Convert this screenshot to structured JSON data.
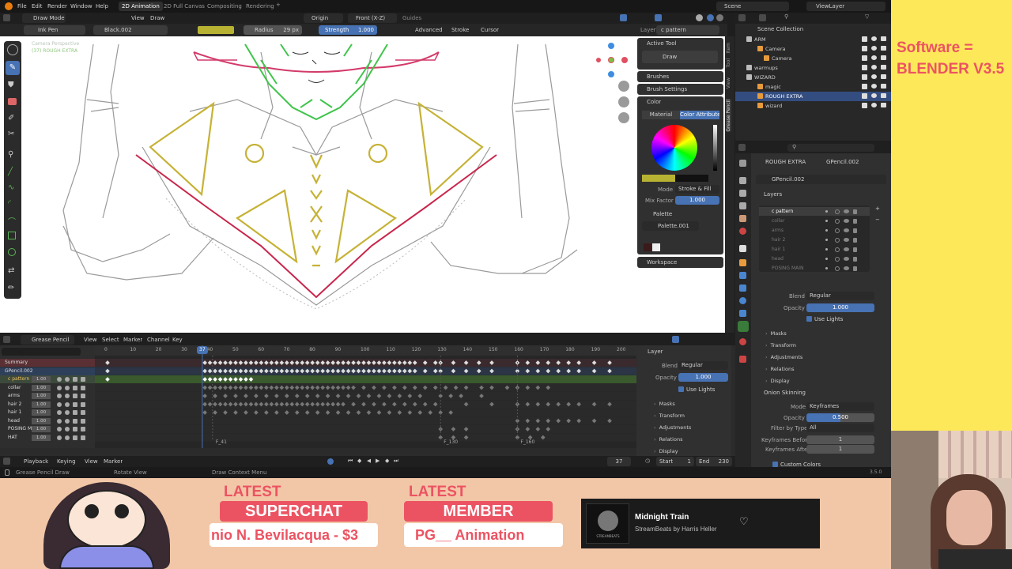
{
  "menubar": {
    "items": [
      "File",
      "Edit",
      "Render",
      "Window",
      "Help"
    ],
    "workspaces": [
      "2D Animation",
      "2D Full Canvas",
      "Compositing",
      "Rendering"
    ],
    "scene": "Scene",
    "viewlayer": "ViewLayer"
  },
  "toolbar": {
    "mode": "Draw Mode",
    "view": "View",
    "draw": "Draw",
    "origin": "Origin",
    "projection": "Front (X-Z)",
    "guides": "Guides"
  },
  "toolsettings": {
    "brush": "Ink Pen",
    "material": "Black.002",
    "radius_label": "Radius",
    "radius_value": "29 px",
    "strength_label": "Strength",
    "strength_value": "1.000",
    "advanced": "Advanced",
    "stroke": "Stroke",
    "cursor": "Cursor",
    "layer_label": "Layer",
    "layer_value": "c pattern"
  },
  "viewport": {
    "camera_text": "Camera Perspective",
    "object_text": "(37) ROUGH EXTRA"
  },
  "npanel": {
    "active_tool": "Active Tool",
    "draw": "Draw",
    "brushes": "Brushes",
    "brush_settings": "Brush Settings",
    "color": "Color",
    "tab_material": "Material",
    "tab_color_attr": "Color Attribute",
    "mode_label": "Mode",
    "mode_value": "Stroke & Fill",
    "mix_label": "Mix Factor",
    "mix_value": "1.000",
    "palette": "Palette",
    "palette_name": "Palette.001",
    "workspace": "Workspace",
    "tabs": [
      "Item",
      "Tool",
      "View",
      "Grease Pencil"
    ]
  },
  "outliner": {
    "title": "Scene Collection",
    "items": [
      {
        "name": "ARM"
      },
      {
        "name": "Camera"
      },
      {
        "name": "Camera"
      },
      {
        "name": "warmups"
      },
      {
        "name": "WIZARD"
      },
      {
        "name": "magic"
      },
      {
        "name": "ROUGH EXTRA"
      },
      {
        "name": "wizard"
      }
    ]
  },
  "properties": {
    "path1": "ROUGH EXTRA",
    "path2": "GPencil.002",
    "data_name": "GPencil.002",
    "layers_title": "Layers",
    "layers": [
      "c pattern",
      "collar",
      "arms",
      "hair 2",
      "hair 1",
      "head",
      "POSING MAIN"
    ],
    "blend_label": "Blend",
    "blend_value": "Regular",
    "opacity_label": "Opacity",
    "opacity_value": "1.000",
    "use_lights": "Use Lights",
    "sections": [
      "Masks",
      "Transform",
      "Adjustments",
      "Relations",
      "Display"
    ],
    "onion": "Onion Skinning",
    "onion_mode_label": "Mode",
    "onion_mode_value": "Keyframes",
    "onion_opacity_label": "Opacity",
    "onion_opacity_value": "0.500",
    "filter_label": "Filter by Type",
    "filter_value": "All",
    "before_label": "Keyframes Before",
    "before_value": "1",
    "after_label": "Keyframes After",
    "after_value": "1",
    "custom_colors": "Custom Colors",
    "version": "3.5.0"
  },
  "timeline": {
    "editor": "Grease Pencil",
    "menus": [
      "View",
      "Select",
      "Marker",
      "Channel",
      "Key"
    ],
    "ticks": [
      "0",
      "10",
      "20",
      "30",
      "40",
      "50",
      "60",
      "70",
      "80",
      "90",
      "100",
      "110",
      "120",
      "130",
      "140",
      "150",
      "160",
      "170",
      "180",
      "190",
      "200"
    ],
    "current_frame": "37",
    "channels": [
      {
        "name": "Summary",
        "value": ""
      },
      {
        "name": "GPencil.002",
        "value": ""
      },
      {
        "name": "c pattern",
        "value": "1.00"
      },
      {
        "name": "collar",
        "value": "1.00"
      },
      {
        "name": "arms",
        "value": "1.00"
      },
      {
        "name": "hair 2",
        "value": "1.00"
      },
      {
        "name": "hair 1",
        "value": "1.00"
      },
      {
        "name": "head",
        "value": "1.00"
      },
      {
        "name": "POSING M",
        "value": "1.00"
      },
      {
        "name": "HAT",
        "value": "1.00"
      }
    ],
    "markers": [
      "F_41",
      "F_130",
      "F_160"
    ],
    "side_layer": "Layer",
    "side_blend_label": "Blend",
    "side_blend_value": "Regular",
    "side_opacity_label": "Opacity",
    "side_opacity_value": "1.000",
    "side_use_lights": "Use Lights",
    "side_sections": [
      "Masks",
      "Transform",
      "Adjustments",
      "Relations",
      "Display"
    ]
  },
  "playback": {
    "playback": "Playback",
    "keying": "Keying",
    "view": "View",
    "marker": "Marker",
    "frame": "37",
    "start_label": "Start",
    "start": "1",
    "end_label": "End",
    "end": "230"
  },
  "statusbar": {
    "left": "Grease Pencil Draw",
    "mid": "Rotate View",
    "right": "Draw Context Menu"
  },
  "overlay": {
    "software": "Software = BLENDER V3.5",
    "latest1": "LATEST",
    "superchat": "SUPERCHAT",
    "superchat_name": "nio N. Bevilacqua - $3",
    "latest2": "LATEST",
    "member": "MEMBER",
    "member_name": "PG__ Animation",
    "song": "Midnight Train",
    "artist": "StreamBeats by Harris Heller",
    "logo_text": "STREAMBEATS"
  },
  "colors": {
    "accent": "#4772b3",
    "overlay_red": "#ec5362",
    "overlay_yellow": "#fde85a"
  }
}
